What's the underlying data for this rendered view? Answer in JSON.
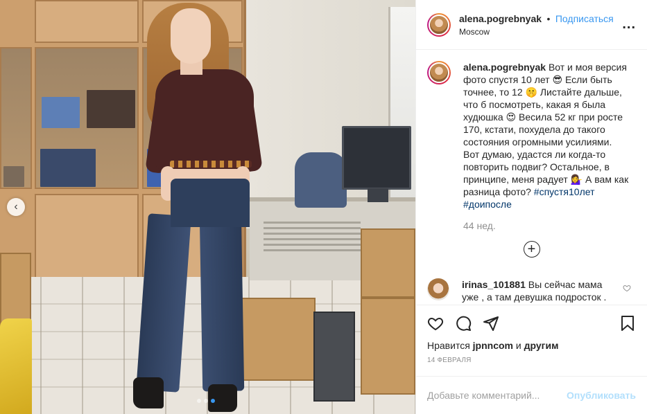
{
  "post": {
    "author": {
      "username": "alena.pogrebnyak",
      "separator": "•",
      "follow_label": "Подписаться",
      "location": "Moscow",
      "more_label": "..."
    },
    "caption": {
      "username": "alena.pogrebnyak",
      "text": "Вот и моя версия фото спустя 10 лет 😎 Если быть точнее, то 12 🤫 Листайте дальше, что б посмотреть, какая я была худюшка 😍 Весила 52 кг при росте 170, кстати, похудела до такого состояния огромными усилиями. Вот думаю, удастся ли когда-то повторить подвиг? Остальное, в принципе, меня радует 💁‍♀️ А вам как разница фото?",
      "hashtags": [
        "#спустя10лет",
        "#доипосле"
      ],
      "age": "44 нед."
    },
    "load_more_label": "+",
    "comments": [
      {
        "username": "irinas_101881",
        "text": "Вы сейчас мама уже , а там девушка подросток ."
      }
    ],
    "likes": {
      "prefix": "Нравится",
      "user": "jpnncom",
      "connector": "и",
      "others": "другим"
    },
    "date": "14 ФЕВРАЛЯ",
    "comment_input": {
      "placeholder": "Добавьте комментарий...",
      "value": ""
    },
    "publish_label": "Опубликовать",
    "carousel": {
      "prev_label": "‹",
      "slide_count": 3,
      "active_index": 2
    },
    "icons": {
      "like": "heart-icon",
      "comment": "comment-icon",
      "share": "share-icon",
      "save": "bookmark-icon"
    }
  }
}
